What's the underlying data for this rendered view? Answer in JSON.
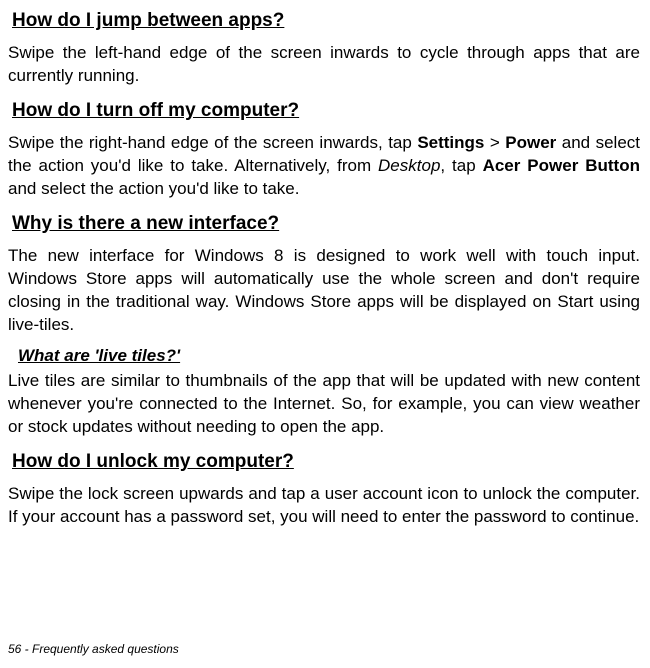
{
  "sections": {
    "jump_apps": {
      "heading": "How do I jump between apps?",
      "body": "Swipe the left-hand edge of the screen inwards to cycle through apps that are currently running."
    },
    "turn_off": {
      "heading": "How do I turn off my computer?",
      "body_pre": "Swipe the right-hand edge of the screen inwards, tap ",
      "settings": "Settings",
      "gt": " > ",
      "power": "Power",
      "body_mid": " and select the action you'd like to take. Alternatively, from ",
      "desktop": "Desktop",
      "body_mid2": ", tap ",
      "acer": "Acer Power Button",
      "body_end": " and select the action you'd like to take."
    },
    "new_interface": {
      "heading": "Why is there a new interface?",
      "body": "The new interface for Windows 8 is designed to work well with touch input. Windows Store apps will automatically use the whole screen and don't require closing in the traditional way. Windows Store apps will be displayed on Start using live-tiles."
    },
    "live_tiles": {
      "heading": "What are 'live tiles?'",
      "body": "Live tiles are similar to thumbnails of the app that will be updated with new content whenever you're connected to the Internet. So, for example, you can view weather or stock updates without needing to open the app."
    },
    "unlock": {
      "heading": "How do I unlock my computer?",
      "body": "Swipe the lock screen upwards and tap a user account icon to unlock the computer. If your account has a password set, you will need to enter the password to continue."
    }
  },
  "footer": "56 - Frequently asked questions"
}
